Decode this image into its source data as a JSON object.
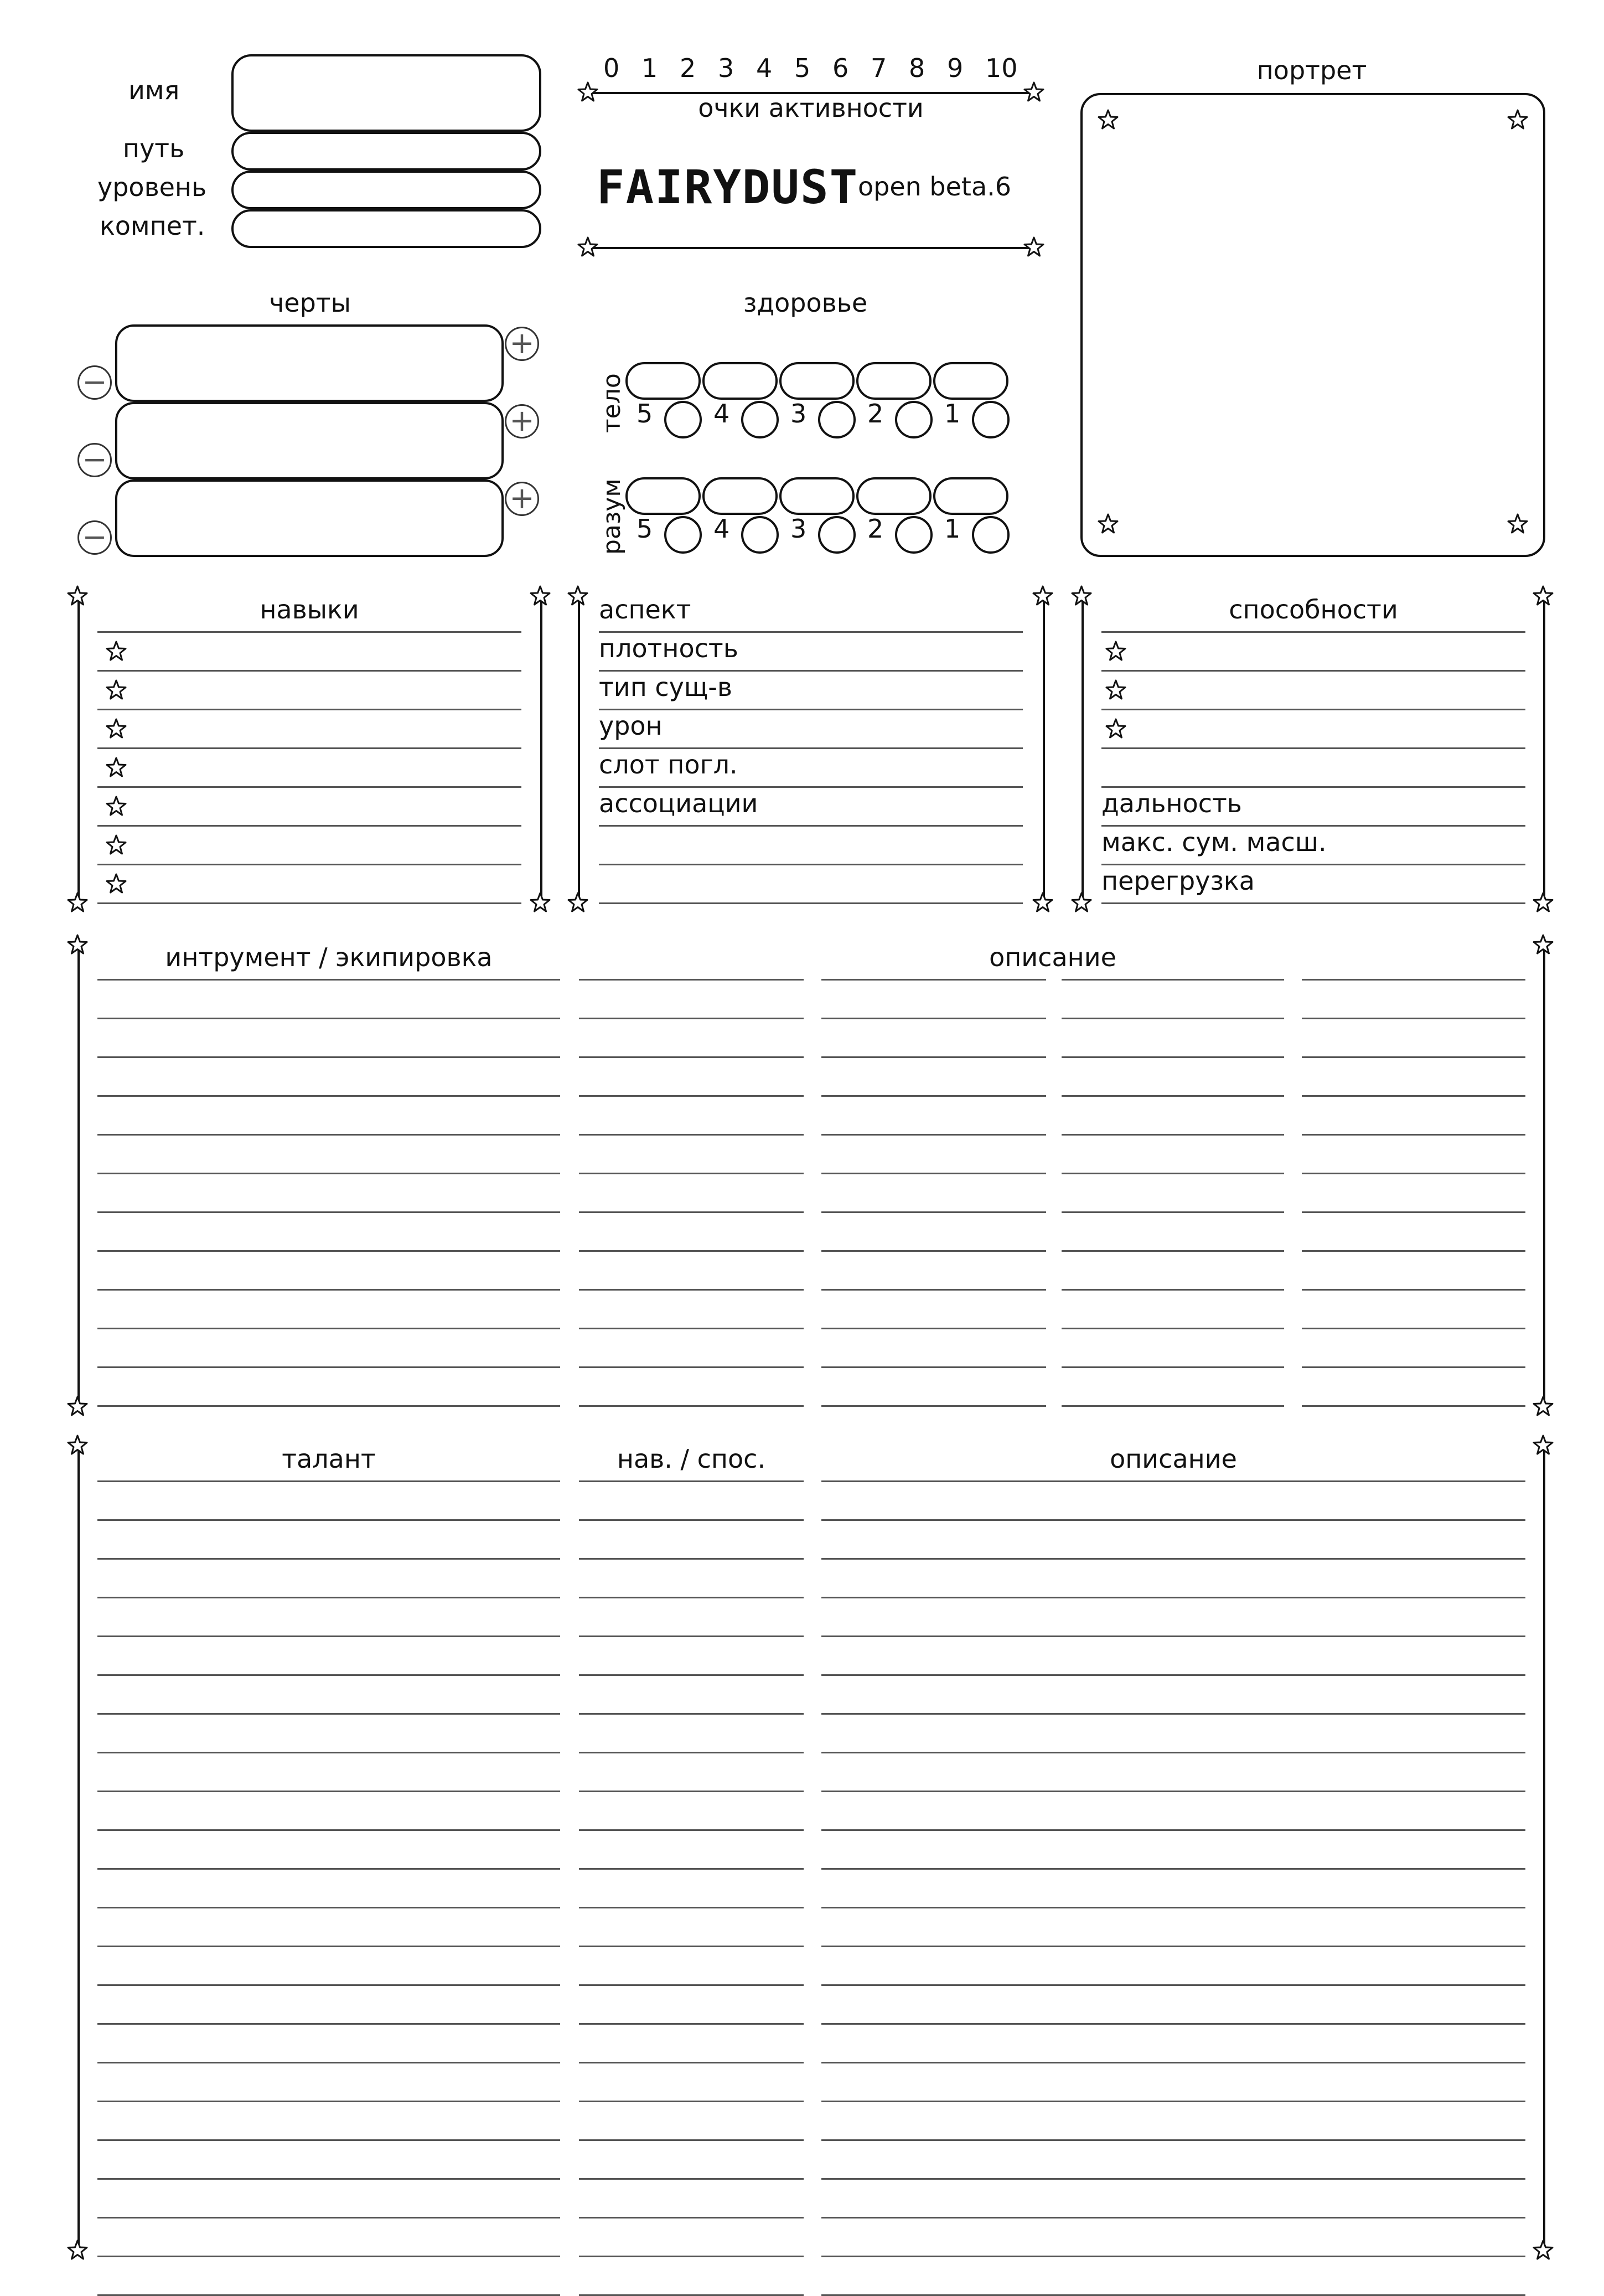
{
  "header": {
    "fields": [
      "имя",
      "путь",
      "уровень",
      "компет."
    ],
    "activity_scale": [
      "0",
      "1",
      "2",
      "3",
      "4",
      "5",
      "6",
      "7",
      "8",
      "9",
      "10"
    ],
    "activity_label": "очки активности",
    "logo": "FAIRYDUST",
    "version": "open beta.6",
    "portrait_label": "портрет"
  },
  "traits": {
    "title": "черты",
    "plus": "+",
    "minus": "−"
  },
  "health": {
    "title": "здоровье",
    "body_label": "тело",
    "mind_label": "разум",
    "levels": [
      "5",
      "4",
      "3",
      "2",
      "1"
    ]
  },
  "skills": {
    "title": "навыки"
  },
  "aspect": {
    "rows": [
      "аспект",
      "плотность",
      "тип сущ-в",
      "урон",
      "слот погл.",
      "ассоциации"
    ]
  },
  "abilities": {
    "title": "способности",
    "rows": [
      "дальность",
      "макс. сум. масш.",
      "перегрузка"
    ]
  },
  "equipment": {
    "title": "интрумент / экипировка",
    "desc": "описание"
  },
  "talents": {
    "title": "талант",
    "col2": "нав. / спос.",
    "desc": "описание"
  },
  "icons": [
    "star-icon",
    "plus-icon",
    "minus-icon"
  ]
}
